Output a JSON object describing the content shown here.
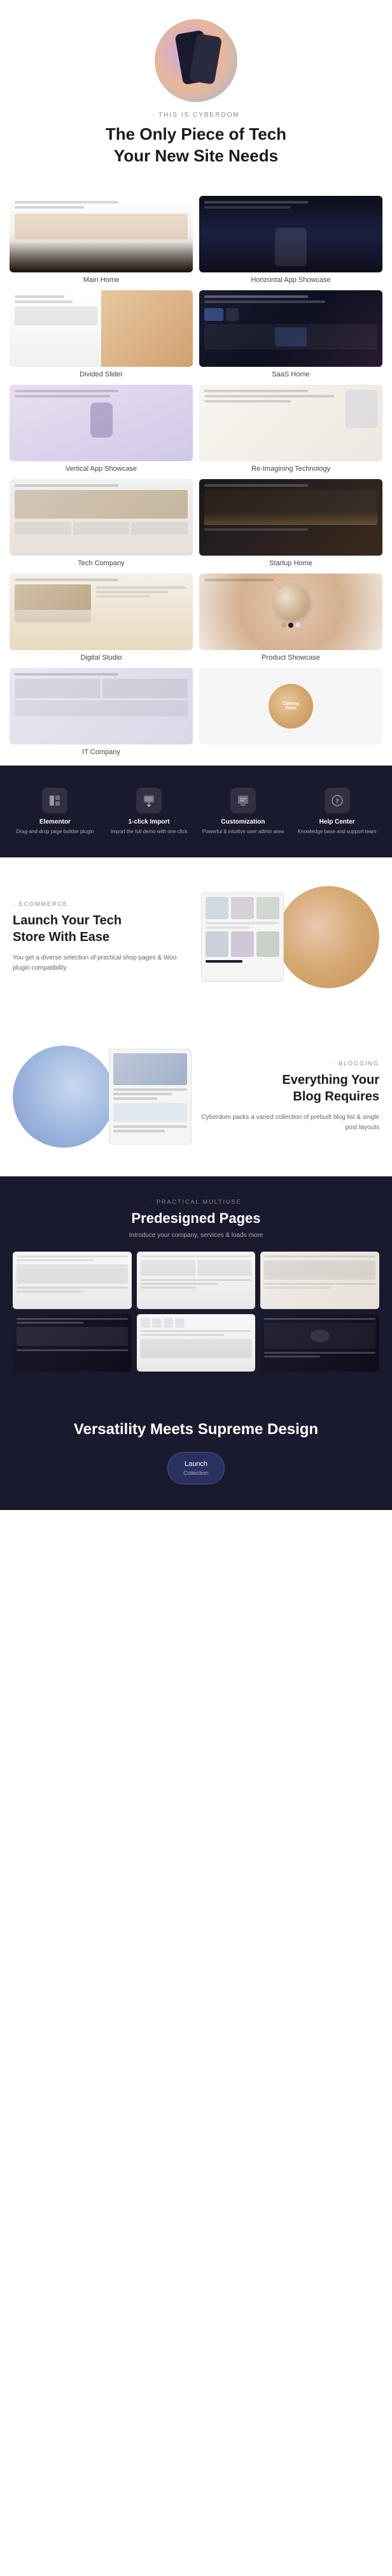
{
  "hero": {
    "tagline": "· THIS IS CYBERDOM",
    "title_line1": "The Only Piece of Tech",
    "title_line2": "Your New Site Needs"
  },
  "demos": [
    {
      "label": "Main Home",
      "class": "thumb-main-home"
    },
    {
      "label": "Horizontal App Showcase",
      "class": "thumb-horizontal"
    },
    {
      "label": "Divided Slider",
      "class": "thumb-divided"
    },
    {
      "label": "SaaS Home",
      "class": "thumb-saas"
    },
    {
      "label": "Vertical App Showcase",
      "class": "thumb-vertical-app"
    },
    {
      "label": "Re-Imagining Technology",
      "class": "thumb-reimagining"
    },
    {
      "label": "Tech Company",
      "class": "thumb-tech"
    },
    {
      "label": "Startup Home",
      "class": "thumb-startup"
    },
    {
      "label": "Digital Studio",
      "class": "thumb-digital"
    },
    {
      "label": "Product Showcase",
      "class": "thumb-product"
    },
    {
      "label": "IT Company",
      "class": "thumb-it"
    },
    {
      "label": "Coming Soon",
      "class": "thumb-coming-soon"
    }
  ],
  "features": [
    {
      "icon": "⬡",
      "title": "Elementor",
      "desc": "Drag-and-drop page builder plugin"
    },
    {
      "icon": "↓",
      "title": "1-click Import",
      "desc": "Import the full demo with one click"
    },
    {
      "icon": "✦",
      "title": "Customization",
      "desc": "Powerful & intuitive user admin area"
    },
    {
      "icon": "?",
      "title": "Help Center",
      "desc": "Knowledge base and support team"
    }
  ],
  "ecommerce": {
    "badge": "· ECOMMERCE",
    "title_line1": "Launch Your Tech",
    "title_line2": "Store With Ease",
    "desc": "You get a diverse selection of practical shop pages & Woo plugin compatibility"
  },
  "blogging": {
    "badge": "· BLOGGING",
    "title_line1": "Everything Your",
    "title_line2": "Blog Requires",
    "desc": "Cyberdom packs a varied collection of prebuilt blog list & single post layouts"
  },
  "predesigned": {
    "badge": "· PRACTICAL MULTIUSE",
    "title": "Predesigned Pages",
    "desc": "Introduce your company, services & loads more"
  },
  "cta": {
    "title_line1": "Versatility Meets Supreme Design",
    "button_line1": "Launch",
    "button_line2": "Collection"
  }
}
